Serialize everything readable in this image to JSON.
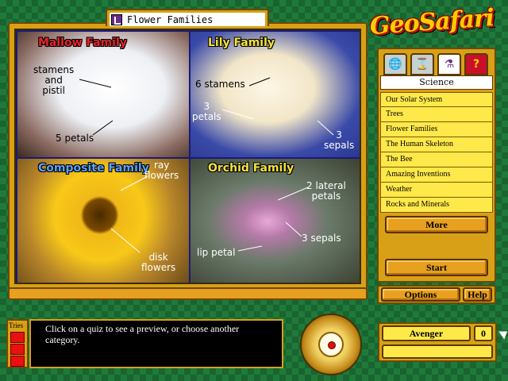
{
  "window": {
    "title": "Flower Families"
  },
  "logo": {
    "text": "GeoSafari"
  },
  "photo": {
    "quadrants": [
      {
        "title": "Mallow Family",
        "title_color": "#e8242a",
        "labels": [
          "stamens\nand\npistil",
          "5 petals"
        ]
      },
      {
        "title": "Lily Family",
        "title_color": "#f4e23a",
        "labels": [
          "6 stamens",
          "3\npetals",
          "3\nsepals"
        ]
      },
      {
        "title": "Composite Family",
        "title_color": "#5aa0ff",
        "labels": [
          "ray\nflowers",
          "disk\nflowers"
        ]
      },
      {
        "title": "Orchid Family",
        "title_color": "#f4e23a",
        "labels": [
          "2 lateral\npetals",
          "3 sepals",
          "lip petal"
        ]
      }
    ]
  },
  "category_panel": {
    "tabs": [
      {
        "name": "geography",
        "icon": "globe-icon",
        "glyph": "🌐"
      },
      {
        "name": "history",
        "icon": "hourglass-icon",
        "glyph": "⌛"
      },
      {
        "name": "science",
        "icon": "flask-icon",
        "glyph": "⚗"
      },
      {
        "name": "mystery",
        "icon": "question-mark-icon",
        "glyph": "?"
      }
    ],
    "active_category": "Science",
    "quizzes": [
      "Our Solar System",
      "Trees",
      "Flower Families",
      "The Human Skeleton",
      "The Bee",
      "Amazing Inventions",
      "Weather",
      "Rocks and Minerals"
    ],
    "more_label": "More",
    "start_label": "Start"
  },
  "controls": {
    "options_label": "Options",
    "help_label": "Help"
  },
  "message": {
    "tries_label": "Tries",
    "text": "Click on a quiz to see a preview, or choose another category."
  },
  "player": {
    "name": "Avenger",
    "score": "0"
  },
  "colors": {
    "background": "#1f7a3a",
    "frame": "#d8a017",
    "list_item": "#ffe94a",
    "button": "#e8a020"
  }
}
